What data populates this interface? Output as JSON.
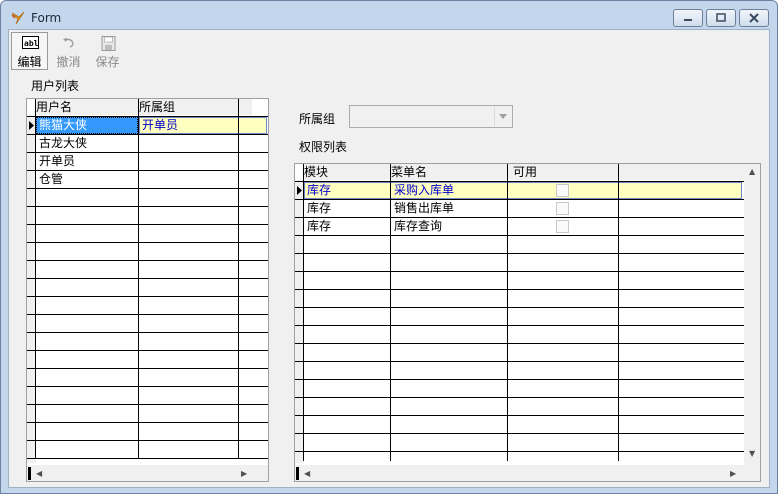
{
  "window": {
    "title": "Form"
  },
  "toolbar": {
    "edit_label": "编辑",
    "undo_label": "撤消",
    "save_label": "保存",
    "edit_icon_text": "abl"
  },
  "users": {
    "section_label": "用户列表",
    "columns": [
      "用户名",
      "所属组"
    ],
    "rows": [
      {
        "name": "熊猫大侠",
        "group": "开单员"
      },
      {
        "name": "古龙大侠",
        "group": ""
      },
      {
        "name": "开单员",
        "group": ""
      },
      {
        "name": "仓管",
        "group": ""
      }
    ]
  },
  "group_field": {
    "label": "所属组",
    "value": ""
  },
  "permissions": {
    "section_label": "权限列表",
    "columns": [
      "模块",
      "菜单名",
      "可用"
    ],
    "rows": [
      {
        "module": "库存",
        "menu": "采购入库单",
        "enabled": false
      },
      {
        "module": "库存",
        "menu": "销售出库单",
        "enabled": false
      },
      {
        "module": "库存",
        "menu": "库存查询",
        "enabled": false
      }
    ]
  },
  "colors": {
    "selected_row": "#3399ff",
    "current_cell_bg": "#ffffc0",
    "link_text": "#0000cc",
    "window_frame": "#c4d6ec"
  }
}
